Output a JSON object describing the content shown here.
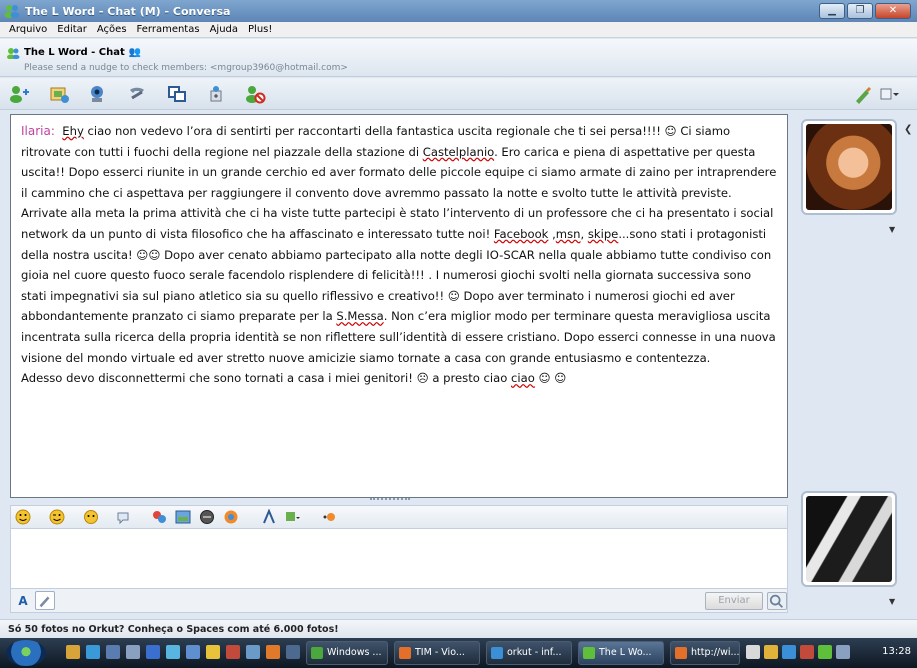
{
  "window": {
    "title": "The L Word - Chat (M) - Conversa",
    "buttons": [
      "minimize",
      "maximize",
      "close"
    ]
  },
  "menu": [
    "Arquivo",
    "Editar",
    "Ações",
    "Ferramentas",
    "Ajuda",
    "Plus!"
  ],
  "contact": {
    "name": "The L Word - Chat",
    "nudge_message": "Please send a nudge to check members: <mgroup3960@hotmail.com>"
  },
  "toolbar_icons": [
    "invite-contact-icon",
    "send-files-icon",
    "video-call-icon",
    "voice-call-icon",
    "activities-icon",
    "games-icon",
    "block-icon"
  ],
  "message": {
    "sender": "Ilaria",
    "parts": [
      {
        "t": "Ehy",
        "u": true
      },
      {
        "t": " ciao non vedevo l’ora di sentirti per raccontarti della fantastica uscita regionale che ti sei persa!!!! ☺  Ci siamo ritrovate con tutti i fuochi della regione nel piazzale della stazione di "
      },
      {
        "t": "Castelplanio",
        "u": true
      },
      {
        "t": ". Ero carica e piena di aspettative per questa uscita!! Dopo esserci riunite in un grande cerchio  ed aver formato delle  piccole equipe  ci siamo armate di zaino per intraprendere  il cammino che ci aspettava per raggiungere il convento dove avremmo passato la notte e svolto tutte le attività previste. Arrivate alla meta la prima  attività che ci ha viste tutte partecipi è stato l’intervento  di un professore che ci ha presentato i social network da un punto di vista filosofico che ha affascinato e interessato  tutte noi! "
      },
      {
        "t": "Facebook",
        "u": true
      },
      {
        "t": " ,"
      },
      {
        "t": "msn",
        "u": true
      },
      {
        "t": ", "
      },
      {
        "t": "skipe",
        "u": true
      },
      {
        "t": "...sono stati i protagonisti della nostra uscita! ☺☺ Dopo aver cenato abbiamo partecipato alla notte degli IO-SCAR  nella quale abbiamo tutte condiviso con gioia nel cuore questo fuoco serale  facendolo  risplendere  di felicità!!! . I numerosi giochi svolti nella giornata successiva sono stati impegnativi sia sul piano atletico sia su quello riflessivo e creativo!! ☺ Dopo aver terminato i  numerosi  giochi ed aver abbondantemente  pranzato ci siamo preparate  per la "
      },
      {
        "t": "S.Messa",
        "u": true
      },
      {
        "t": ". Non c’era miglior modo per terminare questa meravigliosa uscita incentrata sulla ricerca della propria  identità se non riflettere sull’identità  di essere cristiano. Dopo esserci connesse in una nuova visione del mondo virtuale  ed aver stretto nuove amicizie siamo tornate a casa con grande entusiasmo  e  contentezza."
      }
    ],
    "line2_parts": [
      {
        "t": "Adesso devo disconnettermi che sono tornati a casa i miei genitori! ☹       a presto ciao "
      },
      {
        "t": "ciao",
        "u": true
      },
      {
        "t": " ☺ ☺"
      }
    ]
  },
  "input": {
    "send_label": "Enviar",
    "value": ""
  },
  "ad_text": "Só 50 fotos no Orkut? Conheça o Spaces com até 6.000 fotos!",
  "taskbar": {
    "tasks": [
      "Windows ...",
      "TIM - Vio...",
      "orkut - inf...",
      "The L Wo...",
      "http://wi..."
    ],
    "clock": "13:28"
  }
}
